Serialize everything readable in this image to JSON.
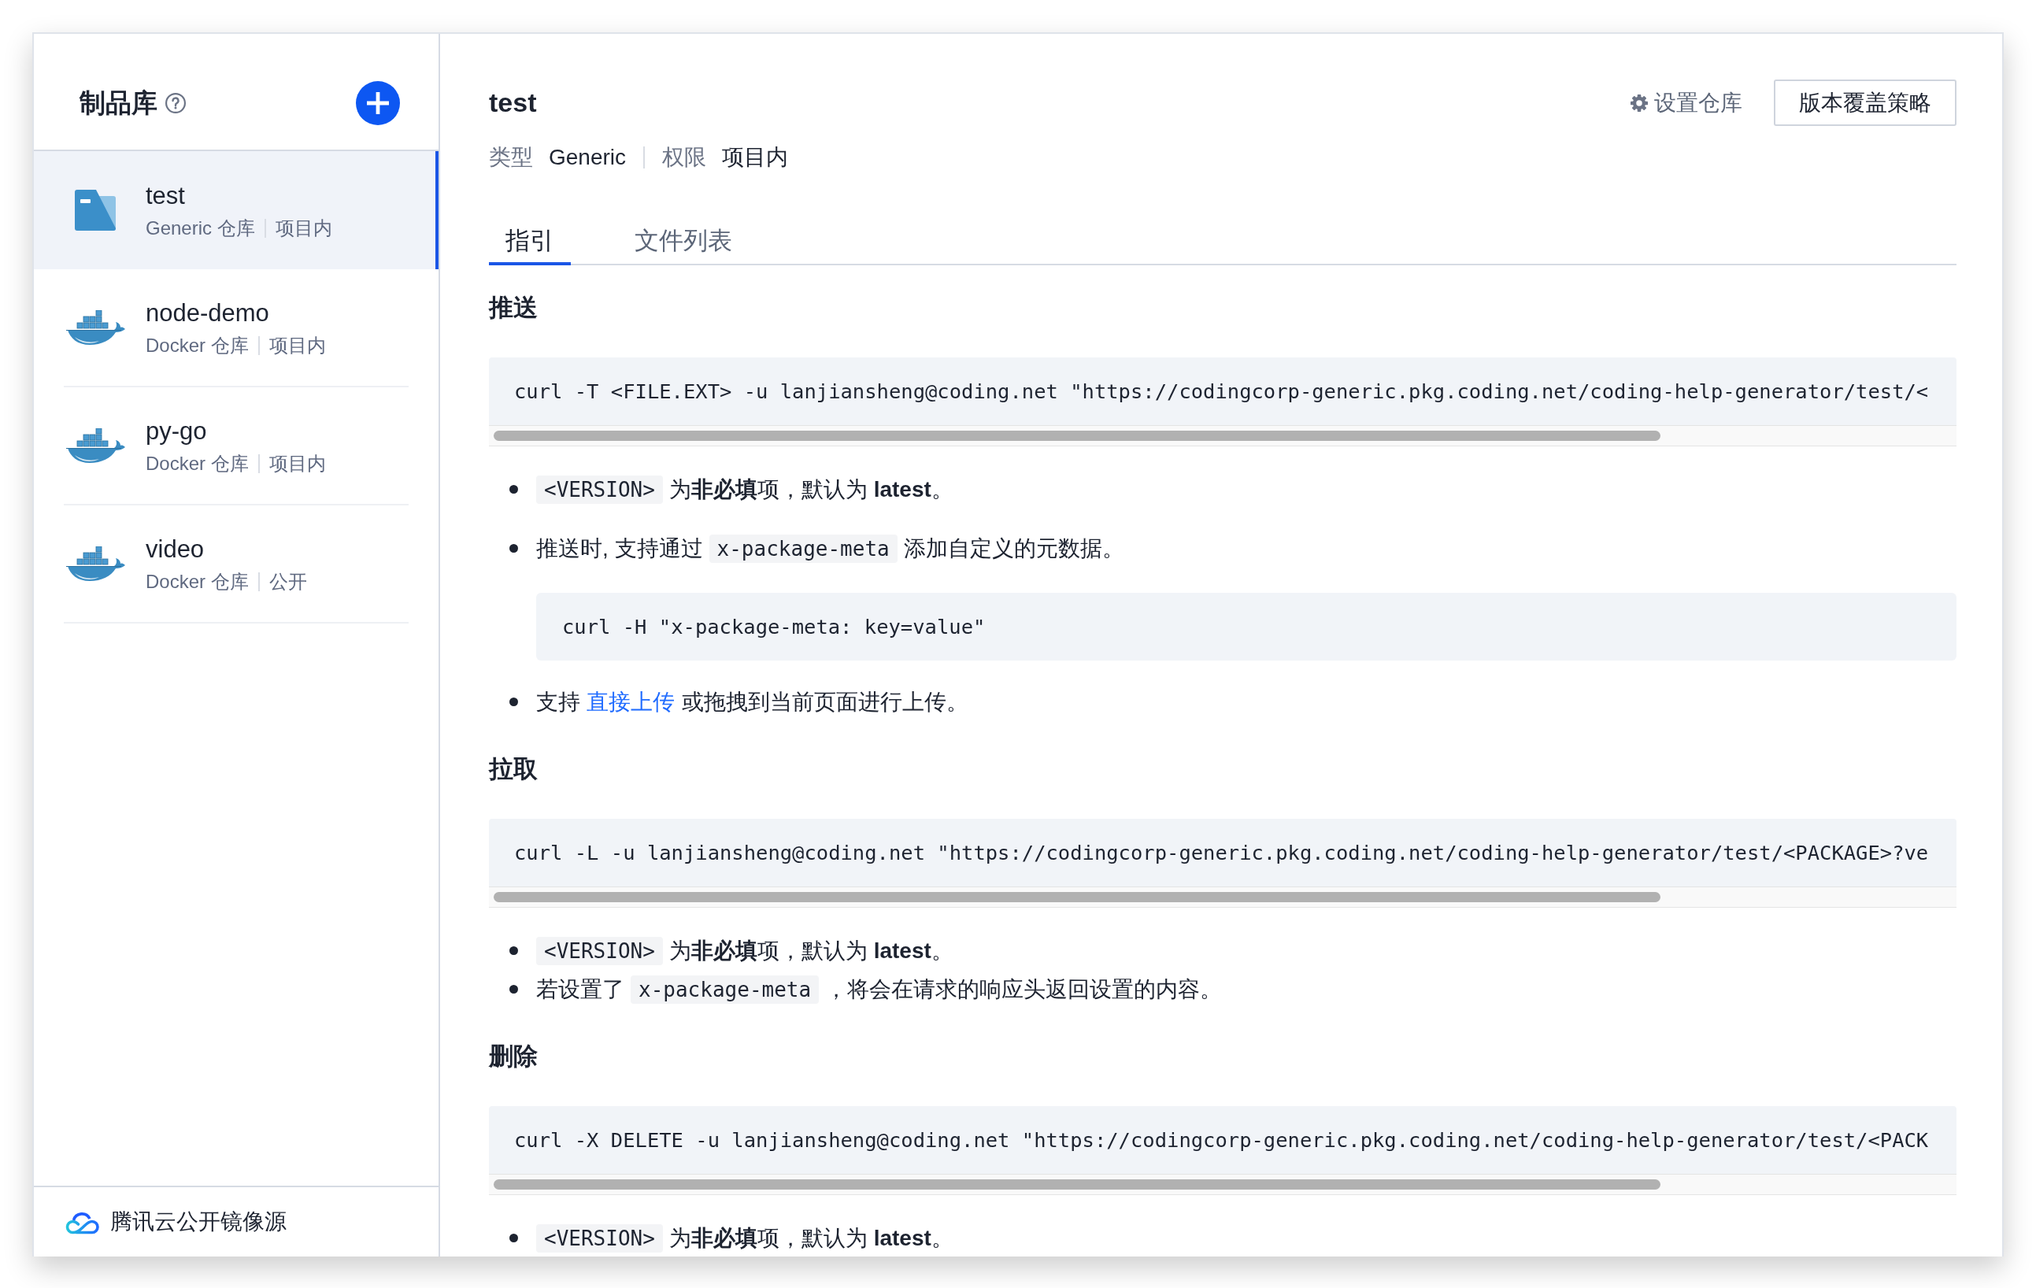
{
  "sidebar": {
    "title": "制品库",
    "repos": [
      {
        "name": "test",
        "type": "Generic 仓库",
        "access": "项目内",
        "kind": "generic",
        "selected": true
      },
      {
        "name": "node-demo",
        "type": "Docker 仓库",
        "access": "项目内",
        "kind": "docker",
        "selected": false
      },
      {
        "name": "py-go",
        "type": "Docker 仓库",
        "access": "项目内",
        "kind": "docker",
        "selected": false
      },
      {
        "name": "video",
        "type": "Docker 仓库",
        "access": "公开",
        "kind": "docker",
        "selected": false
      }
    ],
    "footer": "腾讯云公开镜像源"
  },
  "repo": {
    "title": "test",
    "settings": "设置仓库",
    "policy_button": "版本覆盖策略",
    "meta": [
      {
        "label": "类型",
        "value": "Generic"
      },
      {
        "label": "权限",
        "value": "项目内"
      }
    ]
  },
  "tabs": [
    {
      "label": "指引",
      "selected": true
    },
    {
      "label": "文件列表",
      "selected": false
    }
  ],
  "guide": [
    {
      "heading": "推送",
      "command": "curl -T <FILE.EXT> -u lanjiansheng@coding.net \"https://codingcorp-generic.pkg.coding.net/coding-help-generator/test/<",
      "loose": true,
      "notes": [
        {
          "parts": [
            {
              "kind": "code",
              "text": "<VERSION>"
            },
            {
              "kind": "text",
              "text": "为**非必填**项，默认为 **latest**。"
            }
          ]
        },
        {
          "parts": [
            {
              "kind": "text",
              "text": "推送时, 支持通过"
            },
            {
              "kind": "code",
              "text": "x-package-meta"
            },
            {
              "kind": "text",
              "text": "添加自定义的元数据。"
            }
          ],
          "command": "curl -H \"x-package-meta: key=value\""
        },
        {
          "parts": [
            {
              "kind": "text",
              "text": "支持"
            },
            {
              "kind": "link",
              "text": "直接上传"
            },
            {
              "kind": "text",
              "text": "或拖拽到当前页面进行上传。"
            }
          ]
        }
      ]
    },
    {
      "heading": "拉取",
      "command": "curl -L -u lanjiansheng@coding.net \"https://codingcorp-generic.pkg.coding.net/coding-help-generator/test/<PACKAGE>?ve",
      "loose": false,
      "notes": [
        {
          "parts": [
            {
              "kind": "code",
              "text": "<VERSION>"
            },
            {
              "kind": "text",
              "text": "为**非必填**项，默认为 **latest**。"
            }
          ]
        },
        {
          "parts": [
            {
              "kind": "text",
              "text": "若设置了"
            },
            {
              "kind": "code",
              "text": "x-package-meta"
            },
            {
              "kind": "text",
              "text": "，将会在请求的响应头返回设置的内容。"
            }
          ]
        }
      ]
    },
    {
      "heading": "删除",
      "command": "curl -X DELETE -u lanjiansheng@coding.net \"https://codingcorp-generic.pkg.coding.net/coding-help-generator/test/<PACK",
      "notes": [
        {
          "parts": [
            {
              "kind": "code",
              "text": "<VERSION>"
            },
            {
              "kind": "text",
              "text": "为**非必填**项，默认为 **latest**。"
            }
          ]
        }
      ]
    }
  ]
}
